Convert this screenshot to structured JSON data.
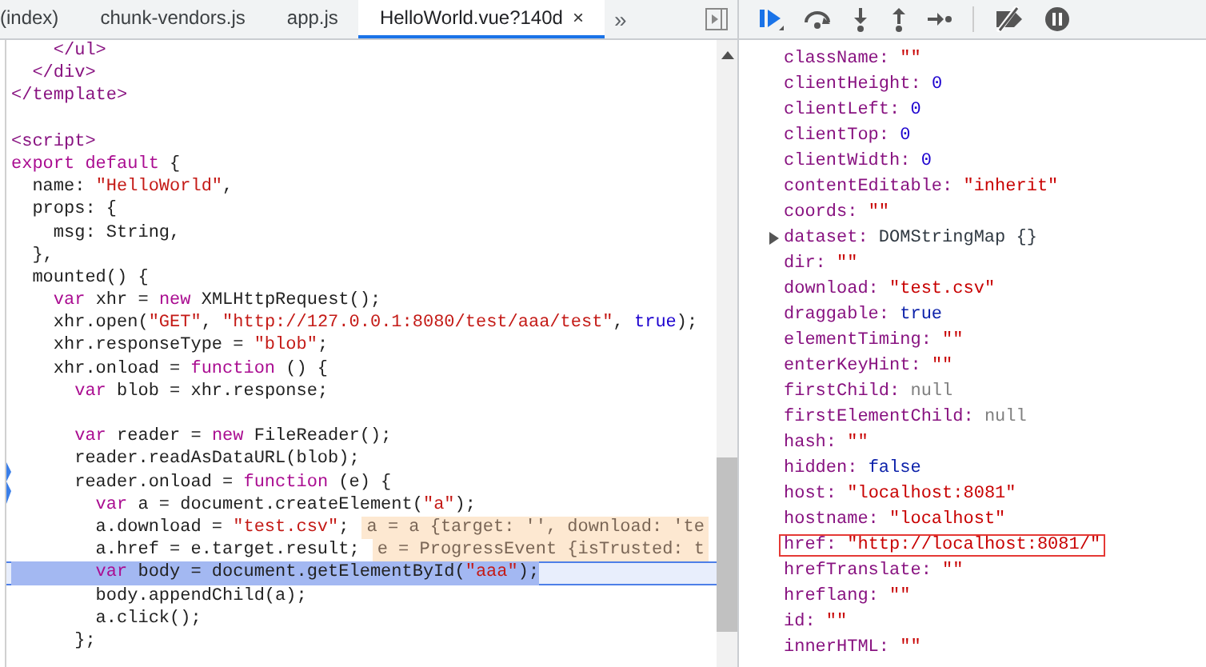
{
  "tabs": [
    {
      "label": "(index)",
      "selected": false
    },
    {
      "label": "chunk-vendors.js",
      "selected": false
    },
    {
      "label": "app.js",
      "selected": false
    },
    {
      "label": "HelloWorld.vue?140d",
      "selected": true,
      "close_label": "×"
    }
  ],
  "tabs_overflow": "»",
  "code_lines": [
    {
      "tokens": [
        {
          "text": "    </ul>",
          "kind": "tag"
        }
      ]
    },
    {
      "tokens": [
        {
          "text": "  </div>",
          "kind": "tag"
        }
      ]
    },
    {
      "tokens": [
        {
          "text": "</template>",
          "kind": "tag"
        }
      ]
    },
    {
      "kind": "blank"
    },
    {
      "tokens": [
        {
          "text": "<script>",
          "kind": "tag"
        }
      ]
    },
    {
      "tokens": [
        {
          "text": "export default",
          "kind": "keyword"
        },
        {
          "text": " {",
          "kind": "plain"
        }
      ]
    },
    {
      "tokens": [
        {
          "text": "  name: ",
          "kind": "plain"
        },
        {
          "text": "\"HelloWorld\"",
          "kind": "string"
        },
        {
          "text": ",",
          "kind": "plain"
        }
      ]
    },
    {
      "tokens": [
        {
          "text": "  props: {",
          "kind": "plain"
        }
      ]
    },
    {
      "tokens": [
        {
          "text": "    msg: String,",
          "kind": "plain"
        }
      ]
    },
    {
      "tokens": [
        {
          "text": "  },",
          "kind": "plain"
        }
      ]
    },
    {
      "tokens": [
        {
          "text": "  mounted() {",
          "kind": "plain"
        }
      ]
    },
    {
      "tokens": [
        {
          "text": "    var",
          "kind": "keyword"
        },
        {
          "text": " xhr = ",
          "kind": "plain"
        },
        {
          "text": "new",
          "kind": "keyword"
        },
        {
          "text": " XMLHttpRequest();",
          "kind": "plain"
        }
      ]
    },
    {
      "tokens": [
        {
          "text": "    xhr.open(",
          "kind": "plain"
        },
        {
          "text": "\"GET\"",
          "kind": "string"
        },
        {
          "text": ", ",
          "kind": "plain"
        },
        {
          "text": "\"http://127.0.0.1:8080/test/aaa/test\"",
          "kind": "string"
        },
        {
          "text": ", ",
          "kind": "plain"
        },
        {
          "text": "true",
          "kind": "atom"
        },
        {
          "text": ");",
          "kind": "plain"
        }
      ]
    },
    {
      "tokens": [
        {
          "text": "    xhr.responseType = ",
          "kind": "plain"
        },
        {
          "text": "\"blob\"",
          "kind": "string"
        },
        {
          "text": ";",
          "kind": "plain"
        }
      ]
    },
    {
      "tokens": [
        {
          "text": "    xhr.onload = ",
          "kind": "plain"
        },
        {
          "text": "function",
          "kind": "keyword"
        },
        {
          "text": " () {",
          "kind": "plain"
        }
      ]
    },
    {
      "tokens": [
        {
          "text": "      var",
          "kind": "keyword"
        },
        {
          "text": " blob = xhr.response;",
          "kind": "plain"
        }
      ]
    },
    {
      "kind": "blank"
    },
    {
      "tokens": [
        {
          "text": "      var",
          "kind": "keyword"
        },
        {
          "text": " reader = ",
          "kind": "plain"
        },
        {
          "text": "new",
          "kind": "keyword"
        },
        {
          "text": " FileReader();",
          "kind": "plain"
        }
      ]
    },
    {
      "tokens": [
        {
          "text": "      reader.readAsDataURL(blob);",
          "kind": "plain"
        }
      ]
    },
    {
      "tokens": [
        {
          "text": "      reader.onload = ",
          "kind": "plain"
        },
        {
          "text": "function",
          "kind": "keyword"
        },
        {
          "text": " (e) {",
          "kind": "plain"
        }
      ],
      "breakpoint": true
    },
    {
      "tokens": [
        {
          "text": "        var",
          "kind": "keyword"
        },
        {
          "text": " a = document.createElement(",
          "kind": "plain"
        },
        {
          "text": "\"a\"",
          "kind": "string"
        },
        {
          "text": ");",
          "kind": "plain"
        }
      ]
    },
    {
      "tokens": [
        {
          "text": "        a.download = ",
          "kind": "plain"
        },
        {
          "text": "\"test.csv\"",
          "kind": "string"
        },
        {
          "text": ";",
          "kind": "plain"
        }
      ],
      "inline_value": "a = a {target: '', download: 'te"
    },
    {
      "tokens": [
        {
          "text": "        a.href = e.target.result;",
          "kind": "plain"
        }
      ],
      "inline_value": "e = ProgressEvent {isTrusted: t"
    },
    {
      "tokens": [
        {
          "text": "        var",
          "kind": "keyword"
        },
        {
          "text": " body = document.getElementById(",
          "kind": "plain"
        },
        {
          "text": "\"aaa\"",
          "kind": "string"
        },
        {
          "text": ");",
          "kind": "plain"
        }
      ],
      "current": true
    },
    {
      "tokens": [
        {
          "text": "        body.appendChild(a);",
          "kind": "plain"
        }
      ]
    },
    {
      "tokens": [
        {
          "text": "        a.click();",
          "kind": "plain"
        }
      ]
    },
    {
      "tokens": [
        {
          "text": "      };",
          "kind": "plain"
        }
      ]
    }
  ],
  "properties": [
    {
      "name": "className:",
      "value": "\"\"",
      "kind": "string"
    },
    {
      "name": "clientHeight:",
      "value": "0",
      "kind": "number"
    },
    {
      "name": "clientLeft:",
      "value": "0",
      "kind": "number"
    },
    {
      "name": "clientTop:",
      "value": "0",
      "kind": "number"
    },
    {
      "name": "clientWidth:",
      "value": "0",
      "kind": "number"
    },
    {
      "name": "contentEditable:",
      "value": "\"inherit\"",
      "kind": "string"
    },
    {
      "name": "coords:",
      "value": "\"\"",
      "kind": "string"
    },
    {
      "name": "dataset:",
      "value": "DOMStringMap {}",
      "kind": "object",
      "expandable": true
    },
    {
      "name": "dir:",
      "value": "\"\"",
      "kind": "string"
    },
    {
      "name": "download:",
      "value": "\"test.csv\"",
      "kind": "string"
    },
    {
      "name": "draggable:",
      "value": "true",
      "kind": "boolean"
    },
    {
      "name": "elementTiming:",
      "value": "\"\"",
      "kind": "string"
    },
    {
      "name": "enterKeyHint:",
      "value": "\"\"",
      "kind": "string"
    },
    {
      "name": "firstChild:",
      "value": "null",
      "kind": "null"
    },
    {
      "name": "firstElementChild:",
      "value": "null",
      "kind": "null"
    },
    {
      "name": "hash:",
      "value": "\"\"",
      "kind": "string"
    },
    {
      "name": "hidden:",
      "value": "false",
      "kind": "boolean"
    },
    {
      "name": "host:",
      "value": "\"localhost:8081\"",
      "kind": "string"
    },
    {
      "name": "hostname:",
      "value": "\"localhost\"",
      "kind": "string"
    },
    {
      "name": "href:",
      "value": "\"http://localhost:8081/\"",
      "kind": "string",
      "highlighted": true
    },
    {
      "name": "hrefTranslate:",
      "value": "\"\"",
      "kind": "string"
    },
    {
      "name": "hreflang:",
      "value": "\"\"",
      "kind": "string"
    },
    {
      "name": "id:",
      "value": "\"\"",
      "kind": "string"
    },
    {
      "name": "innerHTML:",
      "value": "\"\"",
      "kind": "string"
    }
  ]
}
